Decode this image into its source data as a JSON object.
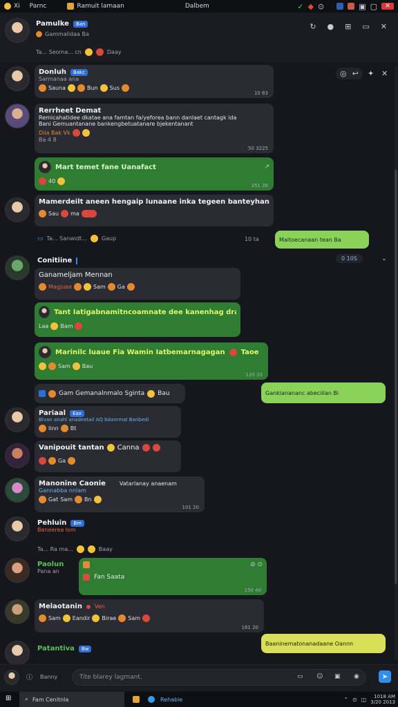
{
  "titlebar": {
    "app_name": "Parnc",
    "chat_title": "Ramuit lamaan",
    "center_label": "Dalbem",
    "left_tag": "Xi"
  },
  "header": {
    "title": "Pamulke",
    "badge": "Ban",
    "subtitle": "Gammalidaa Ba",
    "status_line": "Ta... Seoma... cn",
    "status_tail": "Daay"
  },
  "messages": [
    {
      "name": "Donluh",
      "badge": "Bakc",
      "sub": "Sarmanaa ana",
      "reacts": [
        "Sauna",
        "Bun",
        "Sus"
      ],
      "time": "10 63"
    },
    {
      "name": "Rerrheet Demat",
      "text1": "Remicahatidee dkatae ana famtan fa/yeforea bann danlaet cantagk ida",
      "text2": "Bani Gemuantanane bankengbetuatanare bjekentanant",
      "extra": "Diia Bak Vk",
      "small": "Ba 4 8",
      "time": "50 3225"
    },
    {
      "text": "Mart temet fane Uanafact",
      "sub": "40",
      "time": "351 38"
    },
    {
      "name": "Mamerdeilt aneen hengaip lunaane inka tegeen banteyhan fandat",
      "reacts": [
        "Sau",
        "ma"
      ],
      "status": "Ta... Sanwidt...",
      "status_tail": "Gaup",
      "time": "10 ta"
    },
    {
      "text": "Maitoecanaan tean Ba"
    },
    {
      "name": "Conitiine",
      "time": "0 10S"
    },
    {
      "text": "Ganameljam Mennan",
      "reacts": [
        "Magjuae",
        "Sam",
        "Ga"
      ]
    },
    {
      "text": "Tant Iatigabnamitncoamnate dee kanenhag dramanu",
      "reacts": [
        "Laa",
        "Bam"
      ]
    },
    {
      "text": "Marinilc luaue Fia Wamin Iatbemarnagagan",
      "tail": "Taoe",
      "reacts": [
        "Sam",
        "Bau"
      ],
      "time": "133 33"
    },
    {
      "text": "Gam Gemanalnmalo Sginta",
      "tail": "Bau"
    },
    {
      "text": "Gankianananc abeciilan Bi"
    },
    {
      "name": "Pariaal",
      "badge": "Eax",
      "text": "Bivan anahl anadeetail AQ bdanrmal Banbedi",
      "reacts": [
        "Iinn",
        "Bt"
      ]
    },
    {
      "name": "Vanipouit tantan",
      "tail": "Canna",
      "reacts": [
        "Ga"
      ]
    },
    {
      "name": "Manonine Caonie",
      "text": "Gannabba nnlam",
      "side": "Vatarlanay anaenam",
      "reacts": [
        "Gat",
        "Sam",
        "Bn"
      ],
      "time": "101 20"
    },
    {
      "name": "Pehluin",
      "badge": "Bm",
      "sub": "Beneerea lom",
      "status": "Ta... Ra ma...",
      "status_tail": "Baay"
    },
    {
      "name": "Paolun",
      "sub": "Pana an",
      "text": "Fan Saata",
      "time": "150 40"
    },
    {
      "name": "Melaotanin",
      "tail": "Ven",
      "reacts": [
        "Sam",
        "Eandir",
        "Birae",
        "Sam"
      ],
      "time": "161 20"
    },
    {
      "text": "Baaninematonanadaane Oannn"
    },
    {
      "name": "Patantiva",
      "badge": "Bw"
    }
  ],
  "composer": {
    "label": "Banny",
    "placeholder": "Tite blarey lagmant."
  },
  "taskbar": {
    "search": "Fam Cenitnla",
    "app_label": "Rehabie",
    "clock_time": "1018 AM",
    "clock_date": "3/20 2013"
  }
}
